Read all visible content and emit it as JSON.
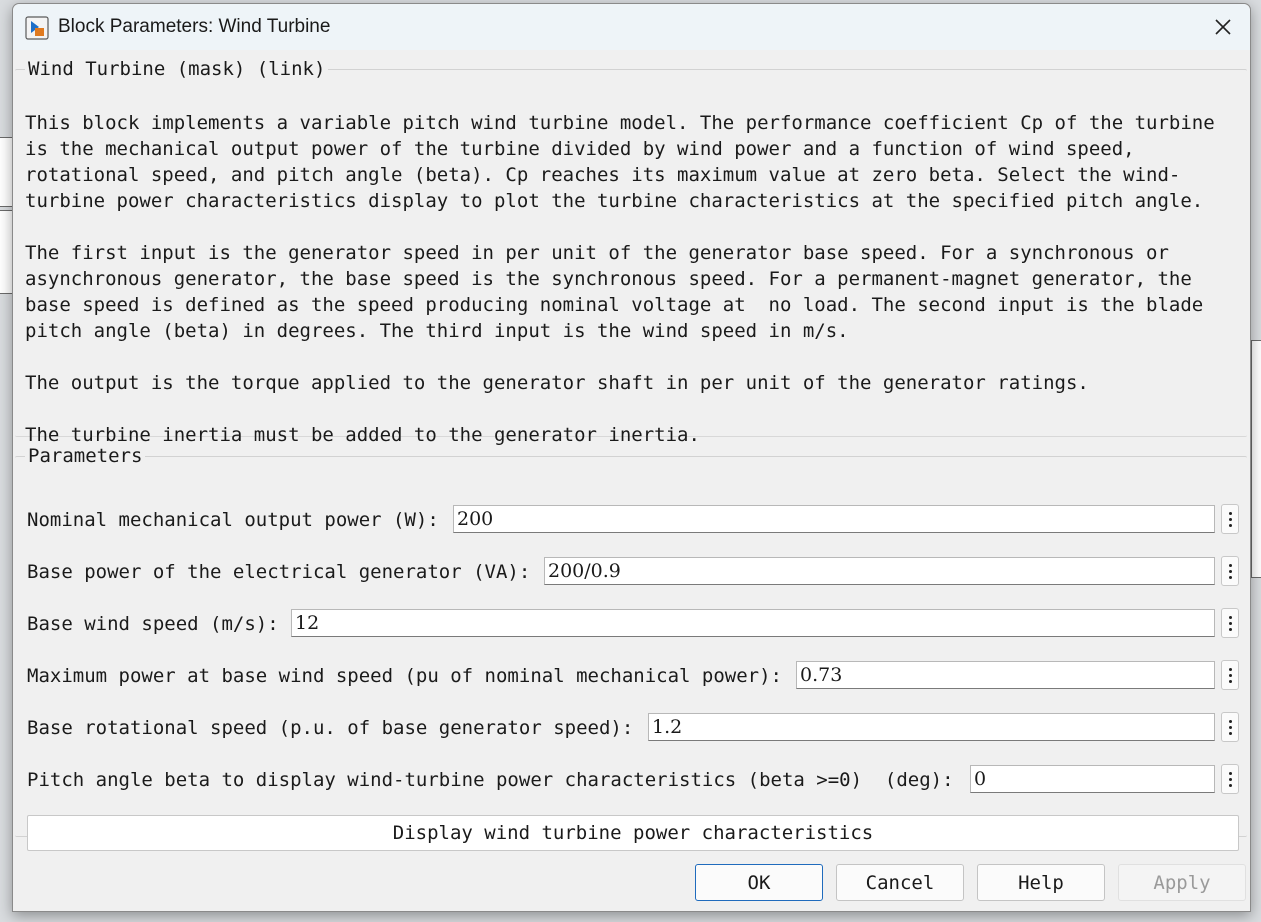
{
  "window": {
    "title": "Block Parameters: Wind Turbine"
  },
  "description": {
    "legend": "Wind Turbine (mask) (link)",
    "text": "This block implements a variable pitch wind turbine model. The performance coefficient Cp of the turbine\nis the mechanical output power of the turbine divided by wind power and a function of wind speed,\nrotational speed, and pitch angle (beta). Cp reaches its maximum value at zero beta. Select the wind-\nturbine power characteristics display to plot the turbine characteristics at the specified pitch angle.\n\nThe first input is the generator speed in per unit of the generator base speed. For a synchronous or\nasynchronous generator, the base speed is the synchronous speed. For a permanent-magnet generator, the\nbase speed is defined as the speed producing nominal voltage at  no load. The second input is the blade\npitch angle (beta) in degrees. The third input is the wind speed in m/s.\n\nThe output is the torque applied to the generator shaft in per unit of the generator ratings.\n\nThe turbine inertia must be added to the generator inertia."
  },
  "parameters": {
    "legend": "Parameters",
    "fields": [
      {
        "label": "Nominal mechanical output power (W):",
        "value": "200"
      },
      {
        "label": "Base power of the electrical generator (VA):",
        "value": "200/0.9"
      },
      {
        "label": "Base wind speed (m/s):",
        "value": "12"
      },
      {
        "label": "Maximum power at base wind speed (pu of nominal mechanical power):",
        "value": "0.73"
      },
      {
        "label": "Base rotational speed (p.u. of base generator speed):",
        "value": "1.2"
      },
      {
        "label": "Pitch angle beta to display wind-turbine power characteristics (beta >=0)  (deg):",
        "value": "0"
      }
    ],
    "display_button": "Display wind turbine power characteristics"
  },
  "buttons": {
    "ok": "OK",
    "cancel": "Cancel",
    "help": "Help",
    "apply": "Apply"
  },
  "icons": {
    "app": "simulink-block-icon",
    "close": "close-icon",
    "more": "vertical-ellipsis-icon"
  },
  "colors": {
    "ok_border": "#1f6bbd",
    "title_bar": "#eef4f8",
    "dialog_bg": "#f0f0f0"
  }
}
